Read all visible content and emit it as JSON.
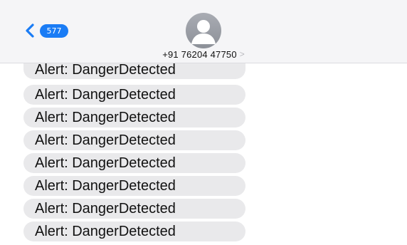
{
  "header": {
    "back_badge": "577",
    "contact_number": "+91 76204 47750",
    "contact_chevron": ">",
    "icons": {
      "back": "chevron-left-icon",
      "avatar": "person-silhouette-icon",
      "contact_chevron": "chevron-right-icon"
    },
    "colors": {
      "accent": "#1a7cf5",
      "header_bg": "#f5f5f7",
      "avatar": "#9a9da4"
    }
  },
  "messages": [
    {
      "text": "Alert: DangerDetected"
    },
    {
      "text": "Alert: DangerDetected"
    },
    {
      "text": "Alert: DangerDetected"
    },
    {
      "text": "Alert: DangerDetected"
    },
    {
      "text": "Alert: DangerDetected"
    },
    {
      "text": "Alert: DangerDetected"
    },
    {
      "text": "Alert: DangerDetected"
    },
    {
      "text": "Alert: DangerDetected"
    }
  ],
  "colors": {
    "bubble_bg": "#e9e9eb",
    "bubble_text": "#111111"
  }
}
